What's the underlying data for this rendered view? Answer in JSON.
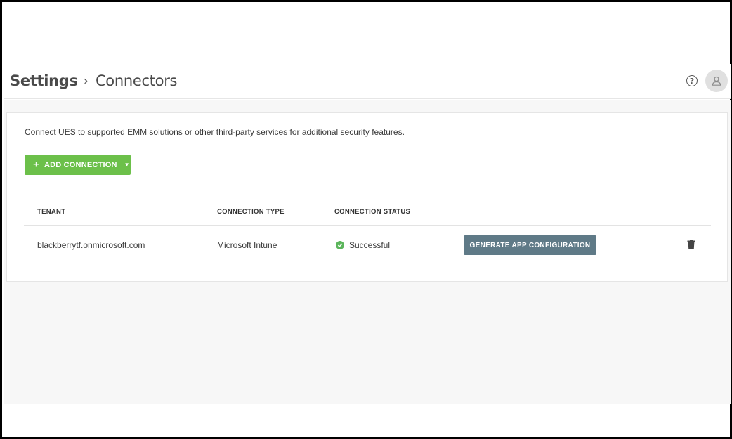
{
  "header": {
    "breadcrumb_root": "Settings",
    "breadcrumb_separator": "›",
    "breadcrumb_current": "Connectors",
    "help_glyph": "?"
  },
  "main": {
    "intro_text": "Connect UES to supported EMM solutions or other third-party services for additional security features.",
    "add_button_label": "ADD CONNECTION",
    "add_button_color": "#6cc04a",
    "table": {
      "columns": [
        "TENANT",
        "CONNECTION TYPE",
        "CONNECTION STATUS"
      ],
      "rows": [
        {
          "tenant": "blackberrytf.onmicrosoft.com",
          "type": "Microsoft Intune",
          "status": "Successful",
          "status_color": "#5bb55b",
          "action_label": "GENERATE APP CONFIGURATION",
          "action_color": "#5f7a87",
          "delete_icon": "trash-icon"
        }
      ]
    }
  }
}
